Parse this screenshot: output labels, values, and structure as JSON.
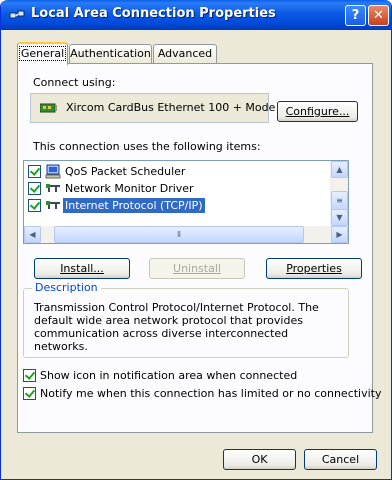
{
  "window": {
    "title": "Local Area Connection Properties",
    "help_label": "?",
    "close_label": "✕"
  },
  "tabs": [
    {
      "label": "General",
      "active": true
    },
    {
      "label": "Authentication",
      "active": false
    },
    {
      "label": "Advanced",
      "active": false
    }
  ],
  "general": {
    "connect_using_label": "Connect using:",
    "adapter_name": "Xircom CardBus Ethernet 100 + Mode",
    "configure_label": "Configure...",
    "items_label": "This connection uses the following items:",
    "items": [
      {
        "label": "QoS Packet Scheduler",
        "checked": true,
        "selected": false,
        "icon": "network-service-icon"
      },
      {
        "label": "Network Monitor Driver",
        "checked": true,
        "selected": false,
        "icon": "protocol-icon"
      },
      {
        "label": "Internet Protocol (TCP/IP)",
        "checked": true,
        "selected": true,
        "icon": "protocol-icon"
      }
    ],
    "install_label": "Install...",
    "uninstall_label": "Uninstall",
    "properties_label": "Properties",
    "description_title": "Description",
    "description_text": "Transmission Control Protocol/Internet Protocol. The default wide area network protocol that provides communication across diverse interconnected networks.",
    "show_icon_label": "Show icon in notification area when connected",
    "show_icon_checked": true,
    "notify_label": "Notify me when this connection has limited or no connectivity",
    "notify_checked": true
  },
  "footer": {
    "ok_label": "OK",
    "cancel_label": "Cancel"
  }
}
